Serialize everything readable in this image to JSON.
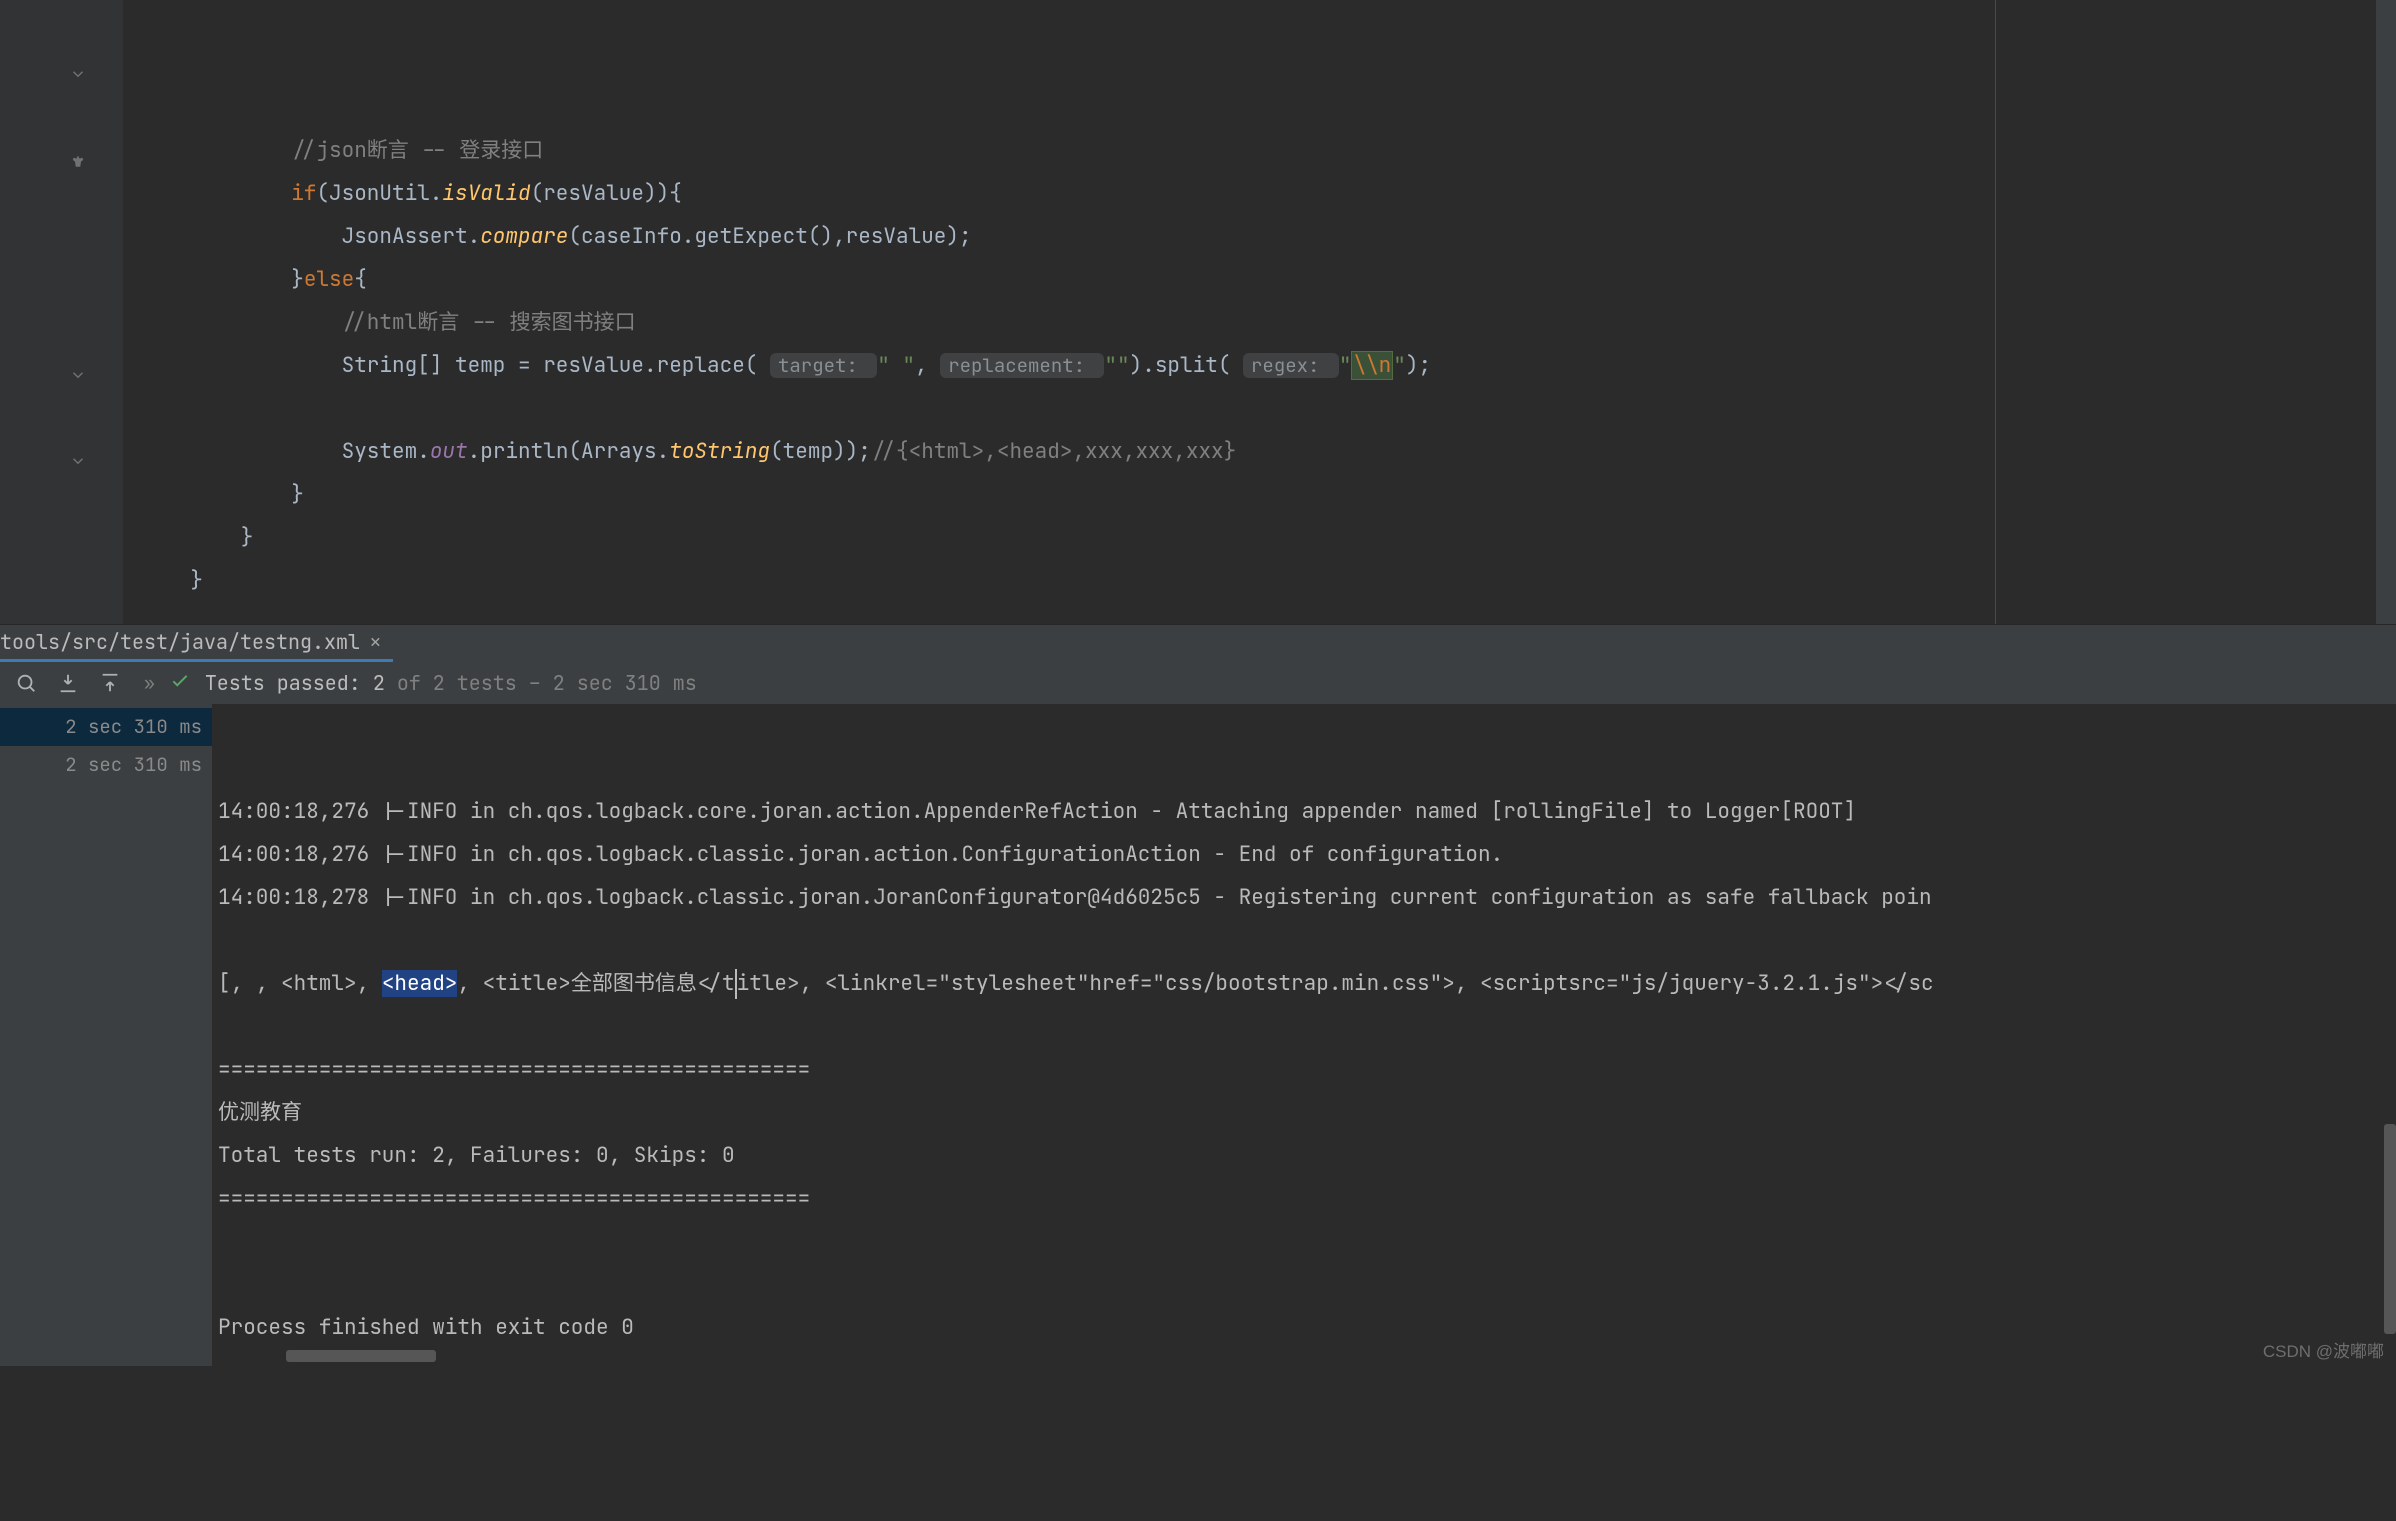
{
  "editor": {
    "lines": [
      {
        "frags": [
          {
            "t": "            "
          },
          {
            "cls": "cm",
            "t": "//json断言 -- 登录接口"
          }
        ]
      },
      {
        "frags": [
          {
            "t": "            "
          },
          {
            "cls": "kw",
            "t": "if"
          },
          {
            "t": "(JsonUtil."
          },
          {
            "cls": "it2",
            "t": "isValid"
          },
          {
            "t": "(resValue)){"
          }
        ]
      },
      {
        "frags": [
          {
            "t": "                JsonAssert."
          },
          {
            "cls": "it2",
            "t": "compare"
          },
          {
            "t": "(caseInfo.getExpect(),resValue);"
          }
        ]
      },
      {
        "frags": [
          {
            "t": "            }"
          },
          {
            "cls": "kw",
            "t": "else"
          },
          {
            "t": "{"
          }
        ]
      },
      {
        "frags": [
          {
            "t": "                "
          },
          {
            "cls": "cm",
            "t": "//html断言 -- 搜索图书接口"
          }
        ]
      },
      {
        "frags": [
          {
            "t": "                String[] temp = resValue.replace( "
          },
          {
            "cls": "hint",
            "t": "target: "
          },
          {
            "cls": "str",
            "t": "\" \""
          },
          {
            "t": ", "
          },
          {
            "cls": "hint",
            "t": "replacement: "
          },
          {
            "cls": "str",
            "t": "\"\""
          },
          {
            "t": ").split( "
          },
          {
            "cls": "hint",
            "t": "regex: "
          },
          {
            "cls": "str",
            "t": "\""
          },
          {
            "cls": "hl-esc",
            "t": "\\\\n"
          },
          {
            "cls": "str",
            "t": "\""
          },
          {
            "t": ");"
          }
        ]
      },
      {
        "frags": [
          {
            "t": " "
          }
        ]
      },
      {
        "frags": [
          {
            "t": "                System."
          },
          {
            "cls": "it",
            "t": "out"
          },
          {
            "t": ".println(Arrays."
          },
          {
            "cls": "it2",
            "t": "toString"
          },
          {
            "t": "(temp));"
          },
          {
            "cls": "cm",
            "t": "//{<html>,<head>,xxx,xxx,xxx}"
          }
        ]
      },
      {
        "frags": [
          {
            "t": "            }"
          }
        ]
      },
      {
        "frags": [
          {
            "t": "        }"
          }
        ]
      },
      {
        "frags": [
          {
            "t": "    }"
          }
        ]
      },
      {
        "frags": [
          {
            "t": " "
          }
        ]
      }
    ],
    "gutter_icons": [
      {
        "row": 1,
        "type": "fold"
      },
      {
        "row": 3,
        "type": "lamp"
      },
      {
        "row": 8,
        "type": "fold-up"
      },
      {
        "row": 10,
        "type": "fold-up"
      }
    ]
  },
  "tab": {
    "path": "tools/src/test/java/testng.xml"
  },
  "toolbar": {
    "passed_label": "Tests passed:",
    "passed_count": "2",
    "meta": "of 2 tests – 2 sec 310 ms"
  },
  "tree": {
    "rows": [
      {
        "label": "2 sec 310 ms",
        "sel": true
      },
      {
        "label": "2 sec 310 ms",
        "sel": false
      }
    ]
  },
  "console": {
    "lines": [
      "14:00:18,276 |-INFO in ch.qos.logback.core.joran.action.AppenderRefAction - Attaching appender named [rollingFile] to Logger[ROOT]",
      "14:00:18,276 |-INFO in ch.qos.logback.classic.joran.action.ConfigurationAction - End of configuration.",
      "14:00:18,278 |-INFO in ch.qos.logback.classic.joran.JoranConfigurator@4d6025c5 - Registering current configuration as safe fallback poin",
      "",
      {
        "pre": "[, , <html>, ",
        "sel": "<head>",
        "post": ", <title>全部图书信息</title>, <linkrel=\"stylesheet\"href=\"css/bootstrap.min.css\">, <scriptsrc=\"js/jquery-3.2.1.js\"></sc",
        "caret_col": 51
      },
      "",
      "===============================================",
      "优测教育",
      "Total tests run: 2, Failures: 0, Skips: 0",
      "===============================================",
      "",
      "",
      "Process finished with exit code 0",
      ""
    ]
  },
  "watermark": "CSDN @波嘟嘟"
}
